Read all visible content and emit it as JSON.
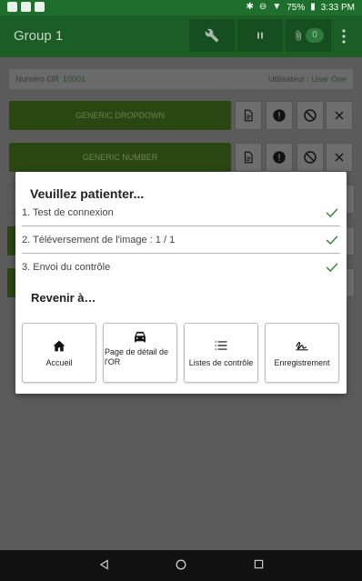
{
  "status_bar": {
    "battery": "75%",
    "time": "3:33 PM"
  },
  "app_bar": {
    "title": "Group 1",
    "attachment_count": "0",
    "icons": [
      "wrench-icon",
      "pause-icon",
      "paperclip-icon",
      "more-vert-icon"
    ]
  },
  "info": {
    "or_label": "Numéro OR",
    "or_value": "10001",
    "user_label": "Utilisateur :",
    "user_value": "User One"
  },
  "fields": [
    {
      "label": "GENERIC DROPDOWN"
    },
    {
      "label": "GENERIC NUMBER"
    }
  ],
  "dialog": {
    "title": "Veuillez patienter...",
    "steps": [
      {
        "label": "1. Test de connexion",
        "done": true
      },
      {
        "label": "2. Téléversement de l'image : 1 / 1",
        "done": true
      },
      {
        "label": "3. Envoi du contrôle",
        "done": true
      }
    ],
    "return_title": "Revenir à…",
    "destinations": [
      {
        "label": "Accueil",
        "icon": "home-icon"
      },
      {
        "label": "Page de détail de l'OR",
        "icon": "car-icon"
      },
      {
        "label": "Listes de contrôle",
        "icon": "list-icon"
      },
      {
        "label": "Enregistrement",
        "icon": "signature-icon"
      }
    ]
  },
  "colors": {
    "primary_dark": "#1a5d25",
    "status_bar": "#1e6f2b",
    "field_green": "#5a8a14",
    "check_green": "#2e8b3a"
  }
}
